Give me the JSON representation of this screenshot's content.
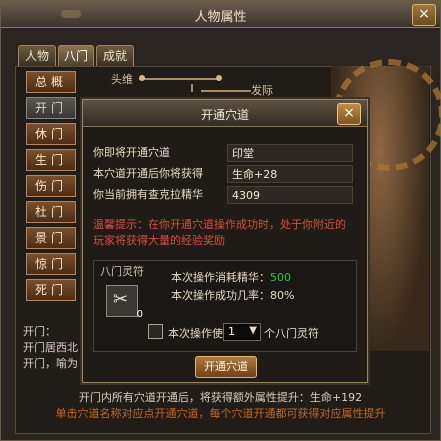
{
  "window": {
    "title": "人物属性",
    "close": "×"
  },
  "tabs": [
    "人物",
    "八门",
    "成就"
  ],
  "side_items": [
    "总概",
    "开门",
    "休门",
    "生门",
    "伤门",
    "杜门",
    "景门",
    "惊门",
    "死门"
  ],
  "acupoint_labels": {
    "a": "头维",
    "b": "发际"
  },
  "info_lines": [
    "开门：",
    "开门居西北",
    "开门，喻为"
  ],
  "bottom": {
    "line1": "开门内所有穴道开通后，将获得额外属性提升：生命+192",
    "line2": "单击穴道名称对应点开通穴道，每个穴道开通都可获得对应属性提升"
  },
  "dialog": {
    "title": "开通穴道",
    "close": "×",
    "rows": [
      {
        "label": "你即将开通穴道",
        "value": "印堂"
      },
      {
        "label": "本穴道开通后你将获得",
        "value": "生命+28"
      },
      {
        "label": "你当前拥有查克拉精华",
        "value": "4309"
      }
    ],
    "warning": "温馨提示：在你开通穴道操作成功时，处于你附近的玩家将获得大量的经验奖励",
    "panel_label": "八门灵符",
    "slot_icon": "✂",
    "slot_count": "0",
    "consume_label": "本次操作消耗精华：",
    "consume_value": "500",
    "success_rate": "本次操作成功几率：80%",
    "use_label": "本次操作使用",
    "use_qty": "1",
    "use_suffix": "个八门灵符",
    "open_button": "开通穴道"
  },
  "colors": {
    "accent_green": "#36c236",
    "warning_red": "#d54f3c",
    "hint_orange": "#c9661e"
  }
}
